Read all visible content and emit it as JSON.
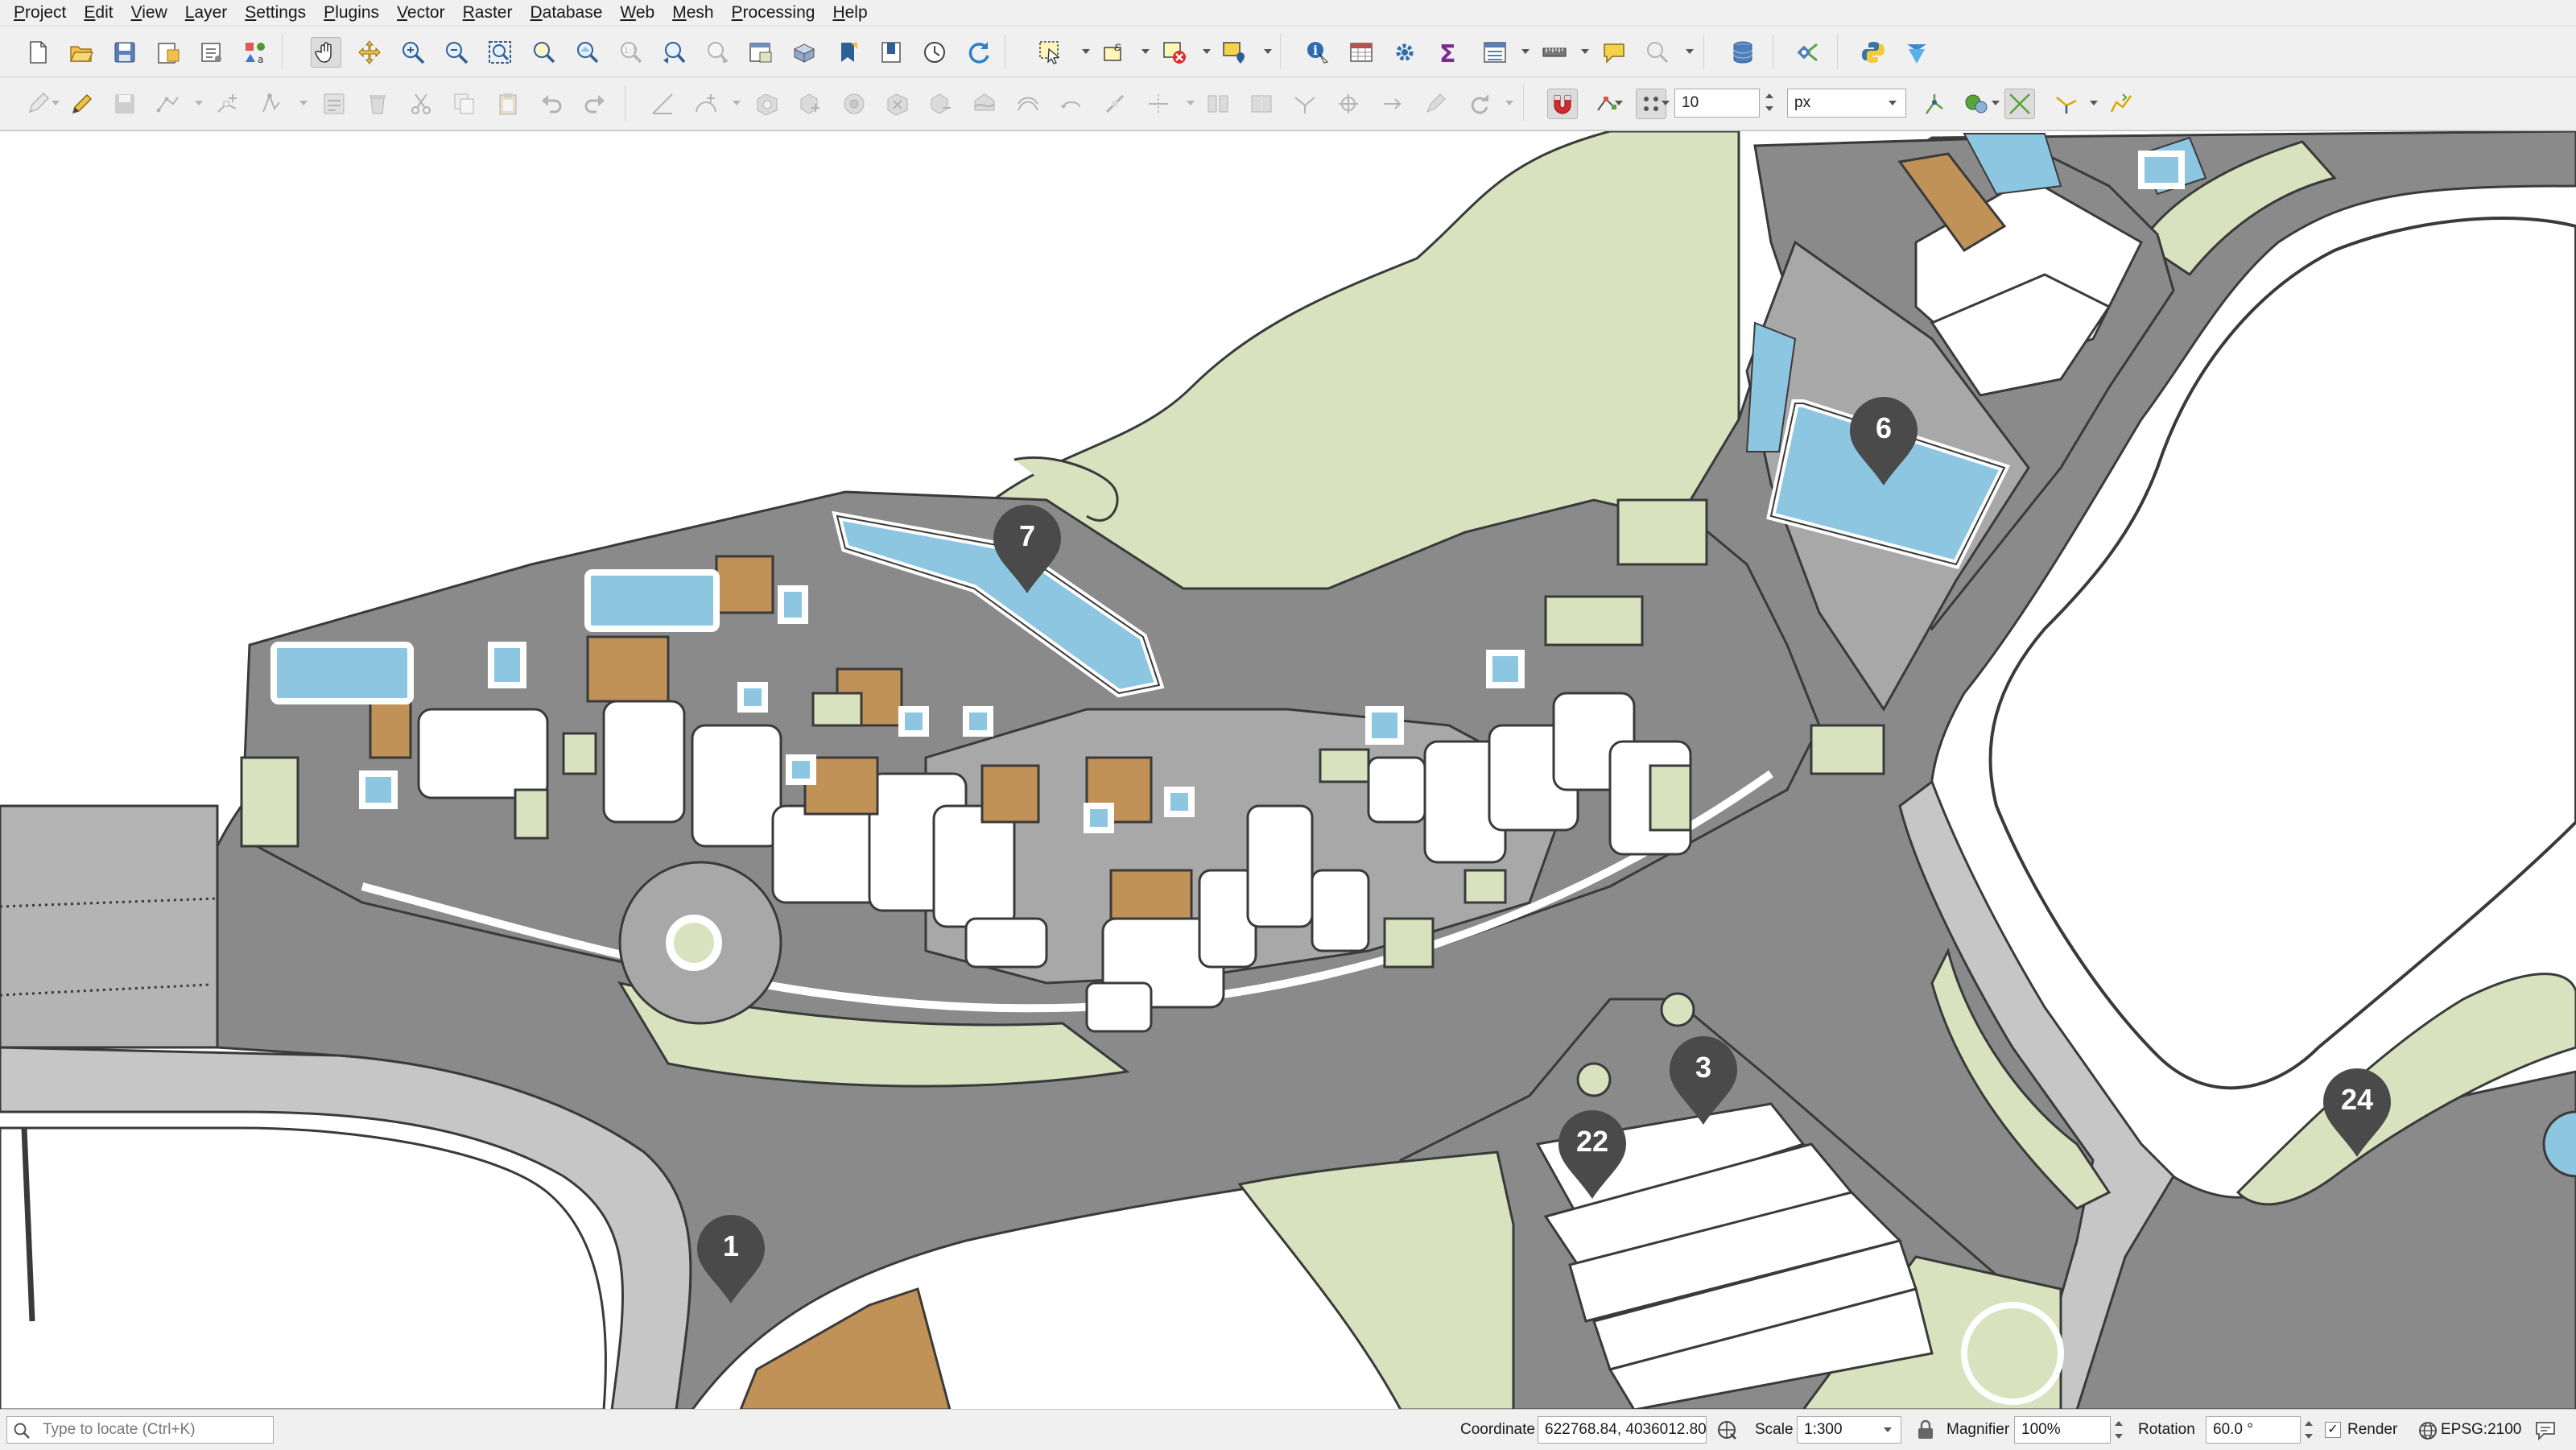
{
  "menubar": {
    "items": [
      "Project",
      "Edit",
      "View",
      "Layer",
      "Settings",
      "Plugins",
      "Vector",
      "Raster",
      "Database",
      "Web",
      "Mesh",
      "Processing",
      "Help"
    ]
  },
  "toolbar1": {
    "icons": [
      "new-project-icon",
      "open-project-icon",
      "save-project-icon",
      "new-print-layout-icon",
      "show-layout-manager-icon",
      "style-manager-icon",
      "pan-map-icon",
      "pan-to-selection-icon",
      "zoom-in-icon",
      "zoom-out-icon",
      "zoom-full-icon",
      "zoom-to-selection-icon",
      "zoom-to-layer-icon",
      "zoom-native-icon",
      "zoom-last-icon",
      "zoom-next-icon",
      "new-map-view-icon",
      "new-3d-map-view-icon",
      "new-spatial-bookmark-icon",
      "show-bookmarks-icon",
      "temporal-controller-icon",
      "refresh-icon",
      "select-features-icon",
      "select-by-expression-icon",
      "deselect-features-icon",
      "select-by-location-icon",
      "identify-features-icon",
      "open-attribute-table-icon",
      "toolbox-icon",
      "statistical-summary-icon",
      "open-field-calculator-icon",
      "measure-line-icon",
      "map-tips-icon",
      "locator-icon",
      "db-manager-icon",
      "gps-plugin-icon",
      "python-console-icon",
      "metasearch-icon"
    ]
  },
  "toolbar2": {
    "snapping_tolerance": "10",
    "snapping_units": "px"
  },
  "map": {
    "labels": {
      "pin_1": "1",
      "pin_3": "3",
      "pin_6": "6",
      "pin_7": "7",
      "pin_22": "22",
      "pin_24": "24"
    }
  },
  "statusbar": {
    "locator_placeholder": "Type to locate (Ctrl+K)",
    "coordinate_label": "Coordinate",
    "coordinate_value": "622768.84, 4036012.80",
    "scale_label": "Scale",
    "scale_value": "1:300",
    "magnifier_label": "Magnifier",
    "magnifier_value": "100%",
    "rotation_label": "Rotation",
    "rotation_value": "60.0 °",
    "render_label": "Render",
    "crs_label": "EPSG:2100"
  },
  "colors": {
    "road_dark": "#808080",
    "paved": "#aaaaaa",
    "grass": "#d9e2bf",
    "water": "#8dc6e1",
    "building_orange": "#c09257",
    "building_white": "#ffffff",
    "pin": "#4a4a4a"
  }
}
